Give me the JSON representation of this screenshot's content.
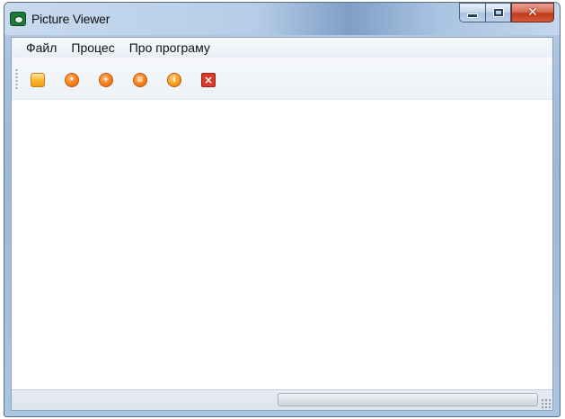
{
  "window": {
    "title": "Picture Viewer",
    "app_icon": "eye-icon",
    "caption_buttons": {
      "minimize_icon": "minimize-icon",
      "maximize_icon": "maximize-icon",
      "close_glyph": "✕"
    }
  },
  "menubar": {
    "items": [
      {
        "label": "Файл"
      },
      {
        "label": "Процес"
      },
      {
        "label": "Про програму"
      }
    ]
  },
  "toolbar": {
    "buttons": [
      {
        "icon": "open-folder-icon",
        "glyph": ""
      },
      {
        "icon": "process-icon-1",
        "glyph": "•"
      },
      {
        "icon": "process-icon-2",
        "glyph": "+"
      },
      {
        "icon": "process-icon-3",
        "glyph": "≡"
      },
      {
        "icon": "info-icon",
        "glyph": "i"
      },
      {
        "icon": "exit-icon",
        "glyph": "×"
      }
    ]
  },
  "statusbar": {
    "progress_fraction": 0
  },
  "colors": {
    "accent_orange": "#f47f1b",
    "close_red": "#d93a2a",
    "titlebar_blue": "#b6cde8"
  }
}
